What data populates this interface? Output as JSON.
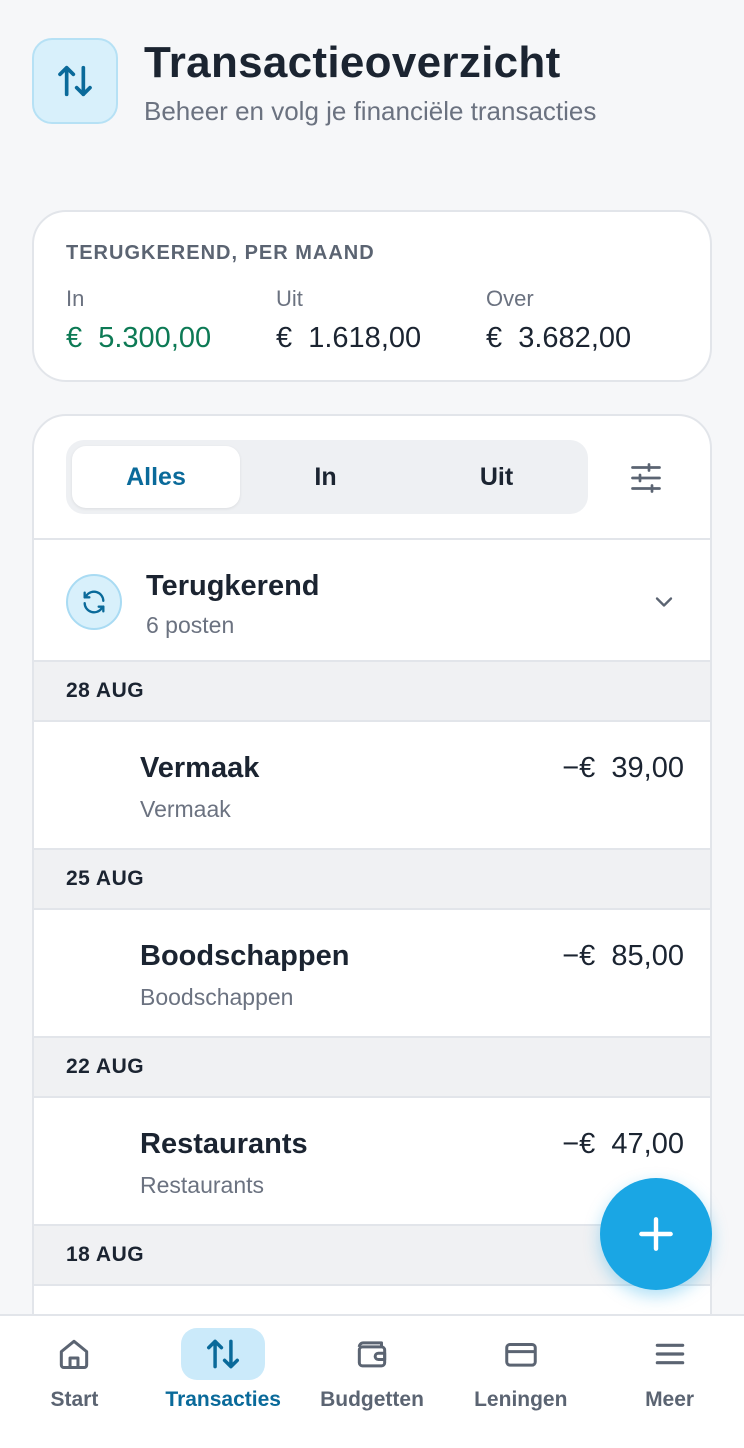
{
  "header": {
    "title": "Transactieoverzicht",
    "subtitle": "Beheer en volg je financiële transacties"
  },
  "summary": {
    "label": "TERUGKEREND, PER MAAND",
    "in_label": "In",
    "in_value": "€  5.300,00",
    "out_label": "Uit",
    "out_value": "€  1.618,00",
    "left_label": "Over",
    "left_value": "€  3.682,00"
  },
  "filters": {
    "all": "Alles",
    "in": "In",
    "out": "Uit",
    "active": "all"
  },
  "recurring": {
    "title": "Terugkerend",
    "count": "6 posten"
  },
  "transactions": [
    {
      "date": "28 AUG",
      "name": "Vermaak",
      "category": "Vermaak",
      "amount": "−€  39,00"
    },
    {
      "date": "25 AUG",
      "name": "Boodschappen",
      "category": "Boodschappen",
      "amount": "−€  85,00"
    },
    {
      "date": "22 AUG",
      "name": "Restaurants",
      "category": "Restaurants",
      "amount": "−€  47,00"
    },
    {
      "date": "18 AUG"
    }
  ],
  "nav": {
    "start": "Start",
    "transactions": "Transacties",
    "budgets": "Budgetten",
    "loans": "Leningen",
    "more": "Meer",
    "active": "transactions"
  },
  "colors": {
    "accent": "#1aa6e4",
    "accent_dark": "#0a6a9a",
    "positive": "#0d7a55"
  }
}
